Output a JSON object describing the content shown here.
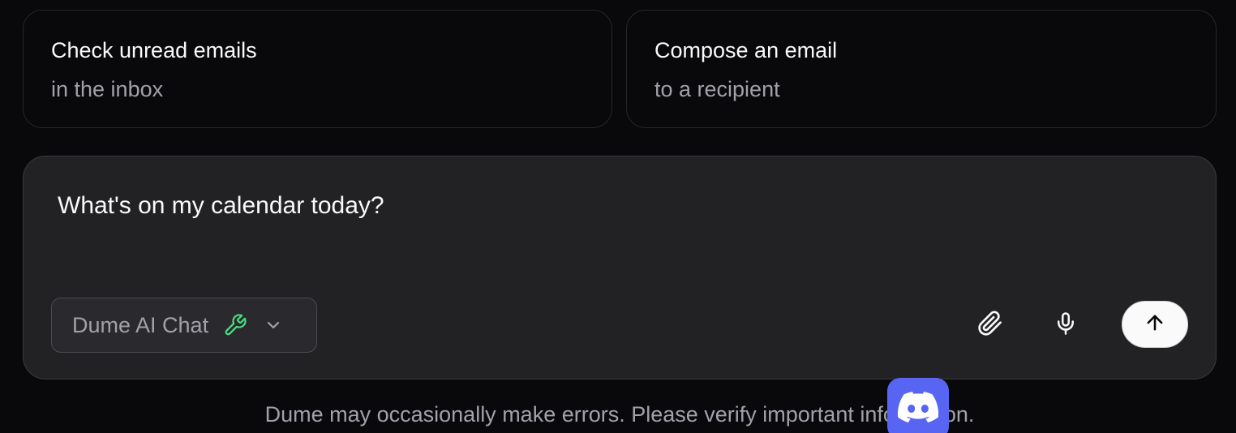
{
  "suggestions": [
    {
      "title": "Check unread emails",
      "subtitle": "in the inbox"
    },
    {
      "title": "Compose an email",
      "subtitle": "to a recipient"
    }
  ],
  "composer": {
    "input_value": "What's on my calendar today?",
    "model_label": "Dume AI Chat",
    "tools_icon": "wrench-icon",
    "dropdown_icon": "chevron-down-icon",
    "attach_icon": "paperclip-icon",
    "mic_icon": "microphone-icon",
    "send_icon": "arrow-up-icon"
  },
  "footer": {
    "disclaimer": "Dume may occasionally make errors. Please verify important information."
  },
  "floating": {
    "discord_icon": "discord-icon"
  },
  "colors": {
    "background": "#09090b",
    "composer_bg": "#222225",
    "tool_icon": "#4ade80",
    "discord": "#5865f2",
    "send_button": "#fafafa"
  }
}
